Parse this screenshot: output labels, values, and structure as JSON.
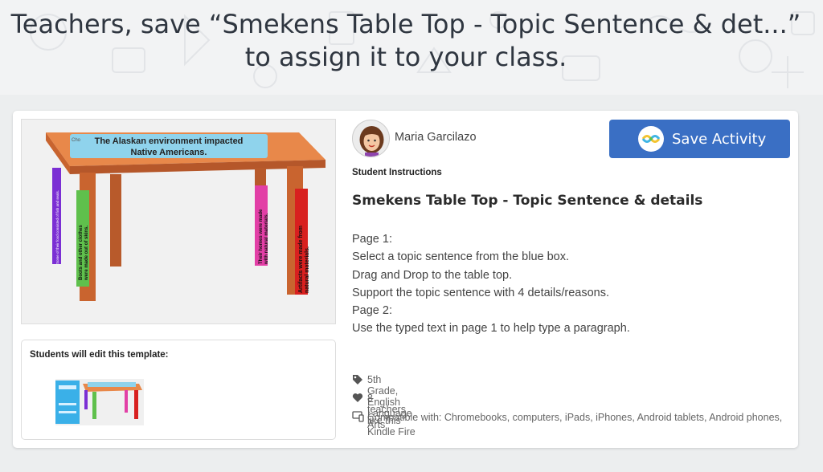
{
  "hero": {
    "line1": "Teachers, save “Smekens Table Top - Topic Sentence & det...”",
    "line2": "to assign it to your class."
  },
  "activity": {
    "author": "Maria Garcilazo",
    "save_label": "Save Activity",
    "instructions_heading": "Student Instructions",
    "title": "Smekens Table Top - Topic Sentence & details",
    "lines": [
      "Page 1:",
      "Select a topic sentence from the blue box.",
      "Drag and Drop to the table top.",
      "Support the topic sentence with 4 details/reasons.",
      "Page 2:",
      "Use the typed text in page 1 to help type a paragraph."
    ],
    "grade_subject": "5th Grade, English Language Arts",
    "likes": "8 teachers like this",
    "compatible": "Compatible with: Chromebooks, computers, iPads, iPhones, Android tablets, Android phones, Kindle Fire"
  },
  "preview": {
    "topic_line1": "The Alaskan environment impacted",
    "topic_line2": "Native Americans.",
    "topic_clip": "Cho",
    "leg1": "Some of their food consisted of fish and seals.",
    "leg2_line1": "Boots and other clothes",
    "leg2_line2": "were made out of skins.",
    "leg3_line1": "Their homes were made",
    "leg3_line2": "with natural materials.",
    "leg4_line1": "Artifacts were made from",
    "leg4_line2": "natural materials."
  },
  "template": {
    "label": "Students will edit this template:"
  },
  "icons": {
    "tag": "tag-icon",
    "heart": "heart-icon",
    "devices": "devices-icon",
    "logo": "seesaw-logo-icon"
  },
  "colors": {
    "accent": "#3a6fc4",
    "table": "#d9773a",
    "topic_box": "#8fd3ec"
  }
}
